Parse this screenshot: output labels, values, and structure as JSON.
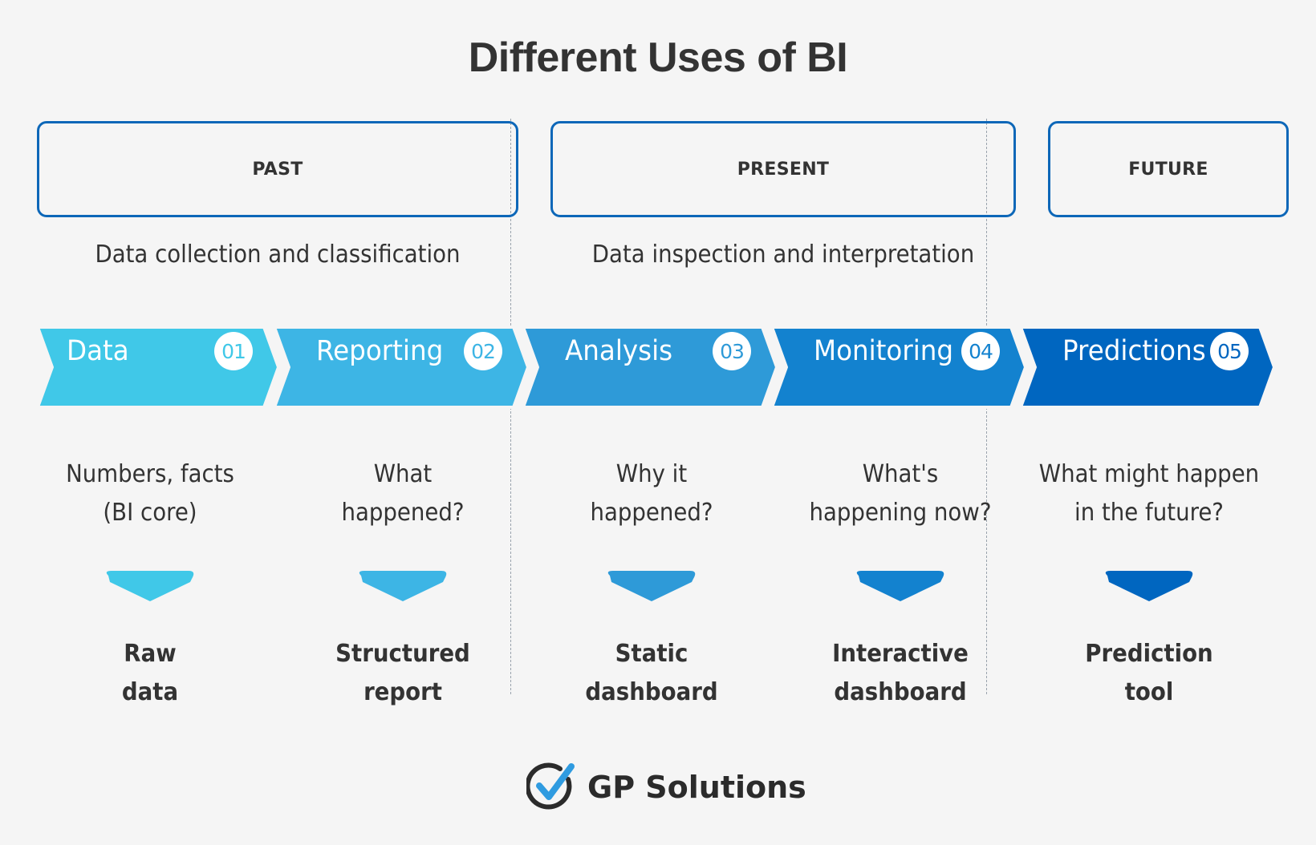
{
  "title": "Different Uses of BI",
  "periods": [
    {
      "label": "PAST",
      "description": "Data collection and classification"
    },
    {
      "label": "PRESENT",
      "description": "Data inspection and interpretation"
    },
    {
      "label": "FUTURE",
      "description": ""
    }
  ],
  "stages": [
    {
      "name": "Data",
      "number": "01",
      "question": "Numbers, facts\n(BI core)",
      "outcome": "Raw\ndata",
      "color": "#40c8e8"
    },
    {
      "name": "Reporting",
      "number": "02",
      "question": "What\nhappened?",
      "outcome": "Structured\nreport",
      "color": "#3db5e5"
    },
    {
      "name": "Analysis",
      "number": "03",
      "question": "Why it\nhappened?",
      "outcome": "Static\ndashboard",
      "color": "#2e9ad8"
    },
    {
      "name": "Monitoring",
      "number": "04",
      "question": "What's\nhappening now?",
      "outcome": "Interactive\ndashboard",
      "color": "#1382cf"
    },
    {
      "name": "Predictions",
      "number": "05",
      "question": "What might happen\nin the future?",
      "outcome": "Prediction\ntool",
      "color": "#0066c0"
    }
  ],
  "colors": {
    "period_border": "#0d67b8",
    "background": "#f5f5f5",
    "text": "#333333",
    "logo_check": "#2f9be0"
  },
  "logo": {
    "text": "GP Solutions",
    "icon": "check-circle-icon"
  }
}
